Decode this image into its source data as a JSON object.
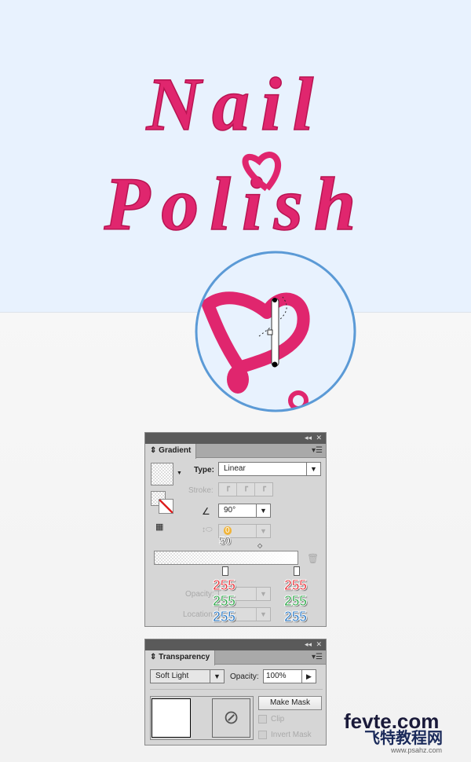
{
  "artwork": {
    "line1": "Nail",
    "line2": "Polish",
    "text_color": "#e0266e",
    "zoom_ring_color": "#5b9ad6"
  },
  "gradient_panel": {
    "tab": "Gradient",
    "type_label": "Type:",
    "type_value": "Linear",
    "stroke_label": "Stroke:",
    "angle_value": "90°",
    "aspect_value": "0",
    "midpoint_annotation": "50",
    "opacity_label": "Opacity:",
    "location_label": "Location:",
    "stops": [
      {
        "r": "255",
        "g": "255",
        "b": "255"
      },
      {
        "r": "255",
        "g": "255",
        "b": "255"
      }
    ],
    "colors": {
      "red": "#e8353c",
      "green": "#2fa84a",
      "blue": "#2a78c4"
    }
  },
  "transparency_panel": {
    "tab": "Transparency",
    "blend_mode": "Soft Light",
    "opacity_label": "Opacity:",
    "opacity_value": "100%",
    "make_mask": "Make Mask",
    "clip": "Clip",
    "invert_mask": "Invert Mask"
  },
  "watermark": {
    "line1": "fevte.com",
    "line2": "飞特教程网",
    "line3": "www.psahz.com"
  }
}
